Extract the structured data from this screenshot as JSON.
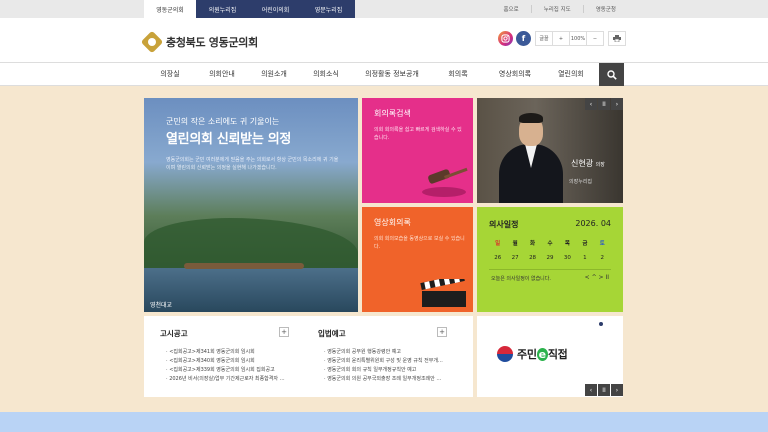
{
  "topbar": {
    "tabs": [
      "영동군의회",
      "의원누리집",
      "어린이의회",
      "영문누리집"
    ],
    "links": [
      "홈으로",
      "누리집 지도",
      "영동군청"
    ]
  },
  "header": {
    "logo_text": "충청북도 영동군의회",
    "social": {
      "instagram": "instagram-icon",
      "facebook": "f"
    },
    "tools": [
      "글꼴",
      "+",
      "100%",
      "−",
      "인쇄"
    ]
  },
  "nav": {
    "items": [
      "의장실",
      "의회안내",
      "의원소개",
      "의회소식",
      "의정활동 정보공개",
      "회의록",
      "영상회의록",
      "열린의회"
    ]
  },
  "hero": {
    "subtitle": "군민의 작은 소리에도 귀 기울이는",
    "title": "열린의회 신뢰받는 의정",
    "desc": "영동군의회는 군민 여러분에게 믿음을 주는 의회로서 항상 군민의 목소리에 귀 기울이며 열린의회 신뢰받는 의정을 실현해 나가겠습니다.",
    "caption": "영천대교"
  },
  "minutes": {
    "title": "회의록검색",
    "desc": "의회 회의록을 쉽고 빠르게 검색하실 수 있습니다."
  },
  "chairman": {
    "name": "신현광",
    "role": "의장",
    "caption": "의장누리집"
  },
  "video": {
    "title": "영상회의록",
    "desc": "의회 회의모습을 동영상으로 보실 수 있습니다."
  },
  "calendar": {
    "title": "의사일정",
    "month": "2026. 04",
    "days": [
      "일",
      "월",
      "화",
      "수",
      "목",
      "금",
      "토"
    ],
    "dates": [
      "26",
      "27",
      "28",
      "29",
      "30",
      "1",
      "2"
    ],
    "note": "오늘은 의사일정이 없습니다.",
    "ctrl": "< ^ >  II"
  },
  "notices": {
    "gosi": {
      "title": "고시공고",
      "items": [
        "<집회공고>제341회 영동군의회 임시회",
        "<집회공고>제340회 영동군의회 임시회",
        "<집회공고>제339회 영동군의회 임시회 집회공고",
        "2026년 비서(의장실)업무 기간제근로자 최종합격자 …"
      ]
    },
    "ipbeop": {
      "title": "입법예고",
      "items": [
        "영동군의회 공무원 행동강령안 예고",
        "영동군의회 윤리특별위원회 구성 및 운영 규칙 전부개…",
        "영동군의회 회의 규칙 일부개정규칙안 예고",
        "영동군의회 의원 공무국외출장 조례 일부개정조례안 …"
      ]
    }
  },
  "banner": {
    "text_a": "주민",
    "text_e": "e",
    "text_b": "직접"
  },
  "arrow_labels": {
    "prev": "‹",
    "pause": "II",
    "next": "›"
  },
  "colors": {
    "navy": "#2d3d6b",
    "pink": "#e52f8a",
    "orange": "#f0632a",
    "green": "#a6d636",
    "beige": "#f6e7cf",
    "footer": "#b9d3f5"
  }
}
